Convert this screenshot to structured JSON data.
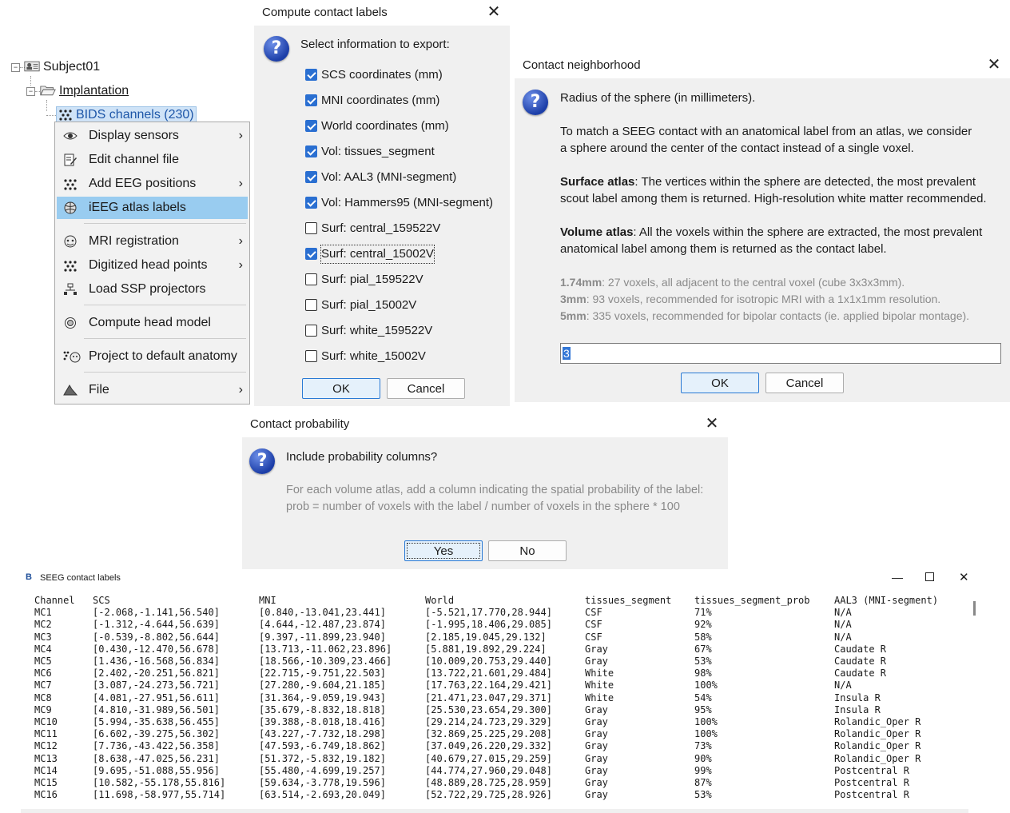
{
  "tree": {
    "subject": "Subject01",
    "implantation": "Implantation",
    "channels": "BIDS channels (230)"
  },
  "context_menu": {
    "items": [
      {
        "label": "Display sensors",
        "icon": "eye-icon",
        "submenu": true
      },
      {
        "label": "Edit channel file",
        "icon": "edit-file-icon",
        "submenu": false
      },
      {
        "label": "Add EEG positions",
        "icon": "dots-icon",
        "submenu": true
      },
      {
        "label": "iEEG atlas labels",
        "icon": "brain-atlas-icon",
        "submenu": false,
        "selected": true
      },
      {
        "label": "MRI registration",
        "icon": "head-mri-icon",
        "submenu": true
      },
      {
        "label": "Digitized head points",
        "icon": "dots-icon",
        "submenu": true
      },
      {
        "label": "Load SSP projectors",
        "icon": "projector-icon",
        "submenu": false
      },
      {
        "label": "Compute head model",
        "icon": "head-model-icon",
        "submenu": false
      },
      {
        "label": "Project to default anatomy",
        "icon": "project-anatomy-icon",
        "submenu": false
      },
      {
        "label": "File",
        "icon": "file-icon",
        "submenu": true
      }
    ]
  },
  "compute_dialog": {
    "title": "Compute contact labels",
    "prompt": "Select information to export:",
    "options": [
      {
        "label": "SCS coordinates (mm)",
        "checked": true
      },
      {
        "label": "MNI coordinates (mm)",
        "checked": true
      },
      {
        "label": "World coordinates (mm)",
        "checked": true
      },
      {
        "label": "Vol: tissues_segment",
        "checked": true
      },
      {
        "label": "Vol: AAL3 (MNI-segment)",
        "checked": true
      },
      {
        "label": "Vol: Hammers95 (MNI-segment)",
        "checked": true
      },
      {
        "label": "Surf: central_159522V",
        "checked": false
      },
      {
        "label": "Surf: central_15002V",
        "checked": true,
        "focused": true
      },
      {
        "label": "Surf: pial_159522V",
        "checked": false
      },
      {
        "label": "Surf: pial_15002V",
        "checked": false
      },
      {
        "label": "Surf: white_159522V",
        "checked": false
      },
      {
        "label": "Surf: white_15002V",
        "checked": false
      }
    ],
    "ok": "OK",
    "cancel": "Cancel"
  },
  "neighborhood_dialog": {
    "title": "Contact neighborhood",
    "heading": "Radius of the sphere (in millimeters).",
    "p1a": "To match a SEEG contact with an anatomical label from an atlas, we consider",
    "p1b": "a sphere around the center of the contact instead of a single voxel.",
    "p2_bold": "Surface atlas",
    "p2a": ": The vertices within the sphere are detected, the most prevalent",
    "p2b": "scout label among them is returned. High-resolution white matter recommended.",
    "p3_bold": "Volume atlas",
    "p3a": ": All the voxels within the sphere are extracted, the most prevalent",
    "p3b": "anatomical label among them is returned as the contact label.",
    "r1_bold": "1.74mm",
    "r1": ": 27 voxels, all adjacent to the central voxel (cube 3x3x3mm).",
    "r2_bold": "3mm",
    "r2": ": 93 voxels, recommended for isotropic MRI with a 1x1x1mm resolution.",
    "r3_bold": "5mm",
    "r3": ": 335 voxels, recommended for bipolar contacts (ie. applied bipolar montage).",
    "input_value": "3",
    "ok": "OK",
    "cancel": "Cancel"
  },
  "probability_dialog": {
    "title": "Contact probability",
    "question": "Include probability columns?",
    "desc1": "For each volume atlas, add a column indicating the spatial probability of the label:",
    "desc2": "prob = number of voxels with the label / number of voxels in the sphere * 100",
    "yes": "Yes",
    "no": "No"
  },
  "seeg_window": {
    "title": "SEEG contact labels",
    "columns": [
      "Channel",
      "SCS",
      "MNI",
      "World",
      "tissues_segment",
      "tissues_segment_prob",
      "AAL3 (MNI-segment)"
    ],
    "rows": [
      [
        "MC1",
        "[-2.068,-1.141,56.540]",
        "[0.840,-13.041,23.441]",
        "[-5.521,17.770,28.944]",
        "CSF",
        "71%",
        "N/A"
      ],
      [
        "MC2",
        "[-1.312,-4.644,56.639]",
        "[4.644,-12.487,23.874]",
        "[-1.995,18.406,29.085]",
        "CSF",
        "92%",
        "N/A"
      ],
      [
        "MC3",
        "[-0.539,-8.802,56.644]",
        "[9.397,-11.899,23.940]",
        "[2.185,19.045,29.132]",
        "CSF",
        "58%",
        "N/A"
      ],
      [
        "MC4",
        "[0.430,-12.470,56.678]",
        "[13.713,-11.062,23.896]",
        "[5.881,19.892,29.224]",
        "Gray",
        "67%",
        "Caudate R"
      ],
      [
        "MC5",
        "[1.436,-16.568,56.834]",
        "[18.566,-10.309,23.466]",
        "[10.009,20.753,29.440]",
        "Gray",
        "53%",
        "Caudate R"
      ],
      [
        "MC6",
        "[2.402,-20.251,56.821]",
        "[22.715,-9.751,22.503]",
        "[13.722,21.601,29.484]",
        "White",
        "98%",
        "Caudate R"
      ],
      [
        "MC7",
        "[3.087,-24.273,56.721]",
        "[27.280,-9.604,21.185]",
        "[17.763,22.164,29.421]",
        "White",
        "100%",
        "N/A"
      ],
      [
        "MC8",
        "[4.081,-27.951,56.611]",
        "[31.364,-9.059,19.943]",
        "[21.471,23.047,29.371]",
        "White",
        "54%",
        "Insula R"
      ],
      [
        "MC9",
        "[4.810,-31.989,56.501]",
        "[35.679,-8.832,18.818]",
        "[25.530,23.654,29.300]",
        "Gray",
        "95%",
        "Insula R"
      ],
      [
        "MC10",
        "[5.994,-35.638,56.455]",
        "[39.388,-8.018,18.416]",
        "[29.214,24.723,29.329]",
        "Gray",
        "100%",
        "Rolandic_Oper R"
      ],
      [
        "MC11",
        "[6.602,-39.275,56.302]",
        "[43.227,-7.732,18.298]",
        "[32.869,25.225,29.208]",
        "Gray",
        "100%",
        "Rolandic_Oper R"
      ],
      [
        "MC12",
        "[7.736,-43.422,56.358]",
        "[47.593,-6.749,18.862]",
        "[37.049,26.220,29.332]",
        "Gray",
        "73%",
        "Rolandic_Oper R"
      ],
      [
        "MC13",
        "[8.638,-47.025,56.231]",
        "[51.372,-5.832,19.182]",
        "[40.679,27.015,29.259]",
        "Gray",
        "90%",
        "Rolandic_Oper R"
      ],
      [
        "MC14",
        "[9.695,-51.088,55.956]",
        "[55.480,-4.699,19.257]",
        "[44.774,27.960,29.048]",
        "Gray",
        "99%",
        "Postcentral R"
      ],
      [
        "MC15",
        "[10.582,-55.178,55.816]",
        "[59.634,-3.778,19.596]",
        "[48.889,28.725,28.959]",
        "Gray",
        "87%",
        "Postcentral R"
      ],
      [
        "MC16",
        "[11.698,-58.977,55.714]",
        "[63.514,-2.693,20.049]",
        "[52.722,29.725,28.926]",
        "Gray",
        "53%",
        "Postcentral R"
      ]
    ]
  },
  "colors": {
    "menu_selection": "#99ccf0",
    "checkbox_checked": "#2a6fd1",
    "dialog_bg": "#f0f0f0",
    "default_button_border": "#2a7ad4"
  }
}
